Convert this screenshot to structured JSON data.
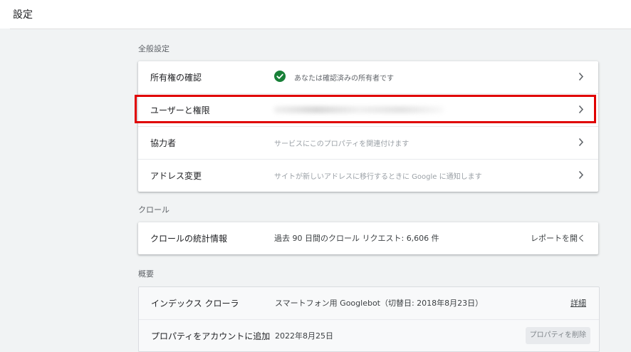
{
  "page": {
    "title": "設定"
  },
  "sections": {
    "general": {
      "label": "全般設定",
      "rows": [
        {
          "label": "所有権の確認",
          "value": "あなたは確認済みの所有者です",
          "icon": "check-circle-icon"
        },
        {
          "label": "ユーザーと権限",
          "value": ""
        },
        {
          "label": "協力者",
          "value": "サービスにこのプロパティを関連付けます"
        },
        {
          "label": "アドレス変更",
          "value": "サイトが新しいアドレスに移行するときに Google に通知します"
        }
      ]
    },
    "crawl": {
      "label": "クロール",
      "rows": [
        {
          "label": "クロールの統計情報",
          "value": "過去 90 日間のクロール リクエスト: 6,606 件",
          "action": "レポートを開く"
        }
      ]
    },
    "overview": {
      "label": "概要",
      "rows": [
        {
          "label": "インデックス クローラ",
          "value": "スマートフォン用 Googlebot（切替日: 2018年8月23日）",
          "action": "詳細"
        },
        {
          "label": "プロパティをアカウントに追加",
          "value": "2022年8月25日",
          "action": "プロパティを削除"
        }
      ]
    }
  },
  "colors": {
    "highlight": "#e00000",
    "check": "#188038"
  }
}
